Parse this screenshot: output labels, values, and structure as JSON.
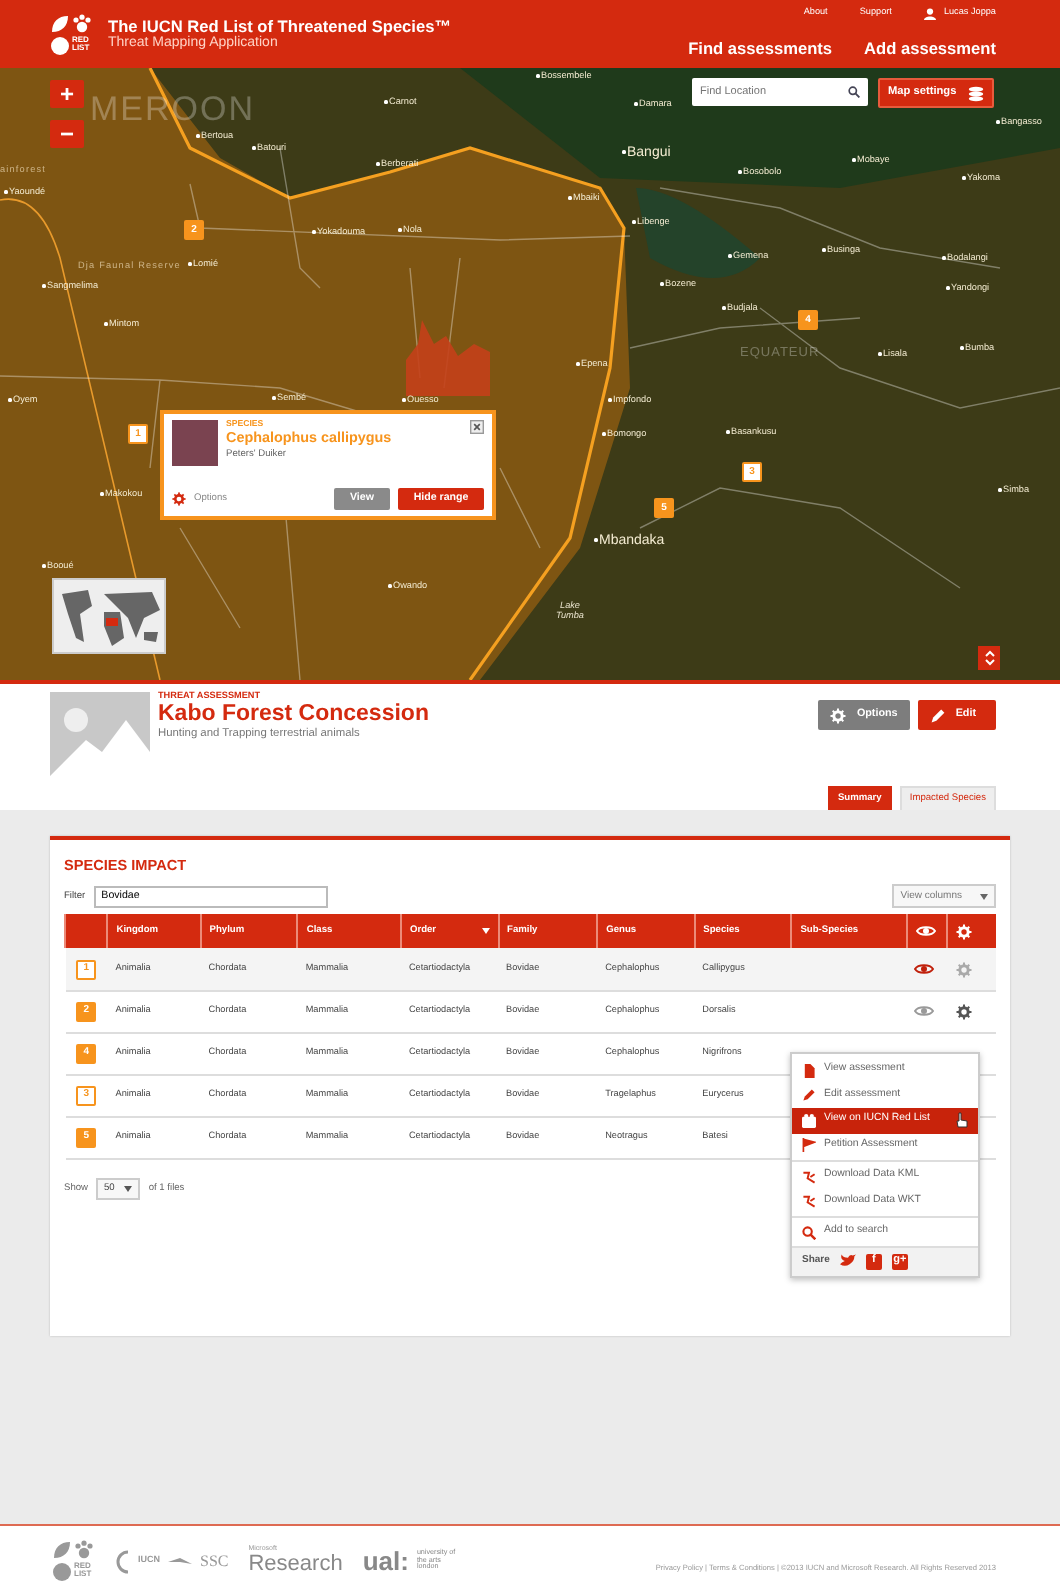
{
  "header": {
    "logo_text": "RED LIST",
    "title": "The IUCN Red List of Threatened Species™",
    "subtitle": "Threat Mapping Application",
    "top_links": [
      "About",
      "Support"
    ],
    "user": "Lucas Joppa",
    "nav": [
      "Find assessments",
      "Add assessment"
    ]
  },
  "map": {
    "zoom_in": "+",
    "zoom_out": "−",
    "search": {
      "placeholder": "Find Location"
    },
    "settings_button": "Map settings",
    "labels": [
      {
        "text": "MEROON",
        "kind": "region"
      },
      {
        "text": "ainforest",
        "kind": "area"
      },
      {
        "text": "Yaoundé",
        "kind": "town"
      },
      {
        "text": "Bossembele",
        "kind": "town"
      },
      {
        "text": "Carnot",
        "kind": "town"
      },
      {
        "text": "Bertoua",
        "kind": "town"
      },
      {
        "text": "Batouri",
        "kind": "town"
      },
      {
        "text": "Berberati",
        "kind": "town"
      },
      {
        "text": "Mbaiki",
        "kind": "town"
      },
      {
        "text": "Damara",
        "kind": "town"
      },
      {
        "text": "Bangui",
        "kind": "city"
      },
      {
        "text": "Bosobolo",
        "kind": "town"
      },
      {
        "text": "Mobaye",
        "kind": "town"
      },
      {
        "text": "Bangasso",
        "kind": "town"
      },
      {
        "text": "Yakoma",
        "kind": "town"
      },
      {
        "text": "Yokadouma",
        "kind": "town"
      },
      {
        "text": "Nola",
        "kind": "town"
      },
      {
        "text": "Libenge",
        "kind": "town"
      },
      {
        "text": "Gemena",
        "kind": "town"
      },
      {
        "text": "Businga",
        "kind": "town"
      },
      {
        "text": "Bodalangi",
        "kind": "town"
      },
      {
        "text": "Yandongi",
        "kind": "town"
      },
      {
        "text": "Dja Faunal Reserve",
        "kind": "area"
      },
      {
        "text": "Lomié",
        "kind": "town"
      },
      {
        "text": "Sangmelima",
        "kind": "town"
      },
      {
        "text": "Mintom",
        "kind": "town"
      },
      {
        "text": "Bozene",
        "kind": "town"
      },
      {
        "text": "Budjala",
        "kind": "town"
      },
      {
        "text": "EQUATEUR",
        "kind": "province"
      },
      {
        "text": "Lisala",
        "kind": "town"
      },
      {
        "text": "Bumba",
        "kind": "town"
      },
      {
        "text": "Epena",
        "kind": "town"
      },
      {
        "text": "Oyem",
        "kind": "town"
      },
      {
        "text": "Sembé",
        "kind": "town"
      },
      {
        "text": "Ouesso",
        "kind": "town"
      },
      {
        "text": "Impfondo",
        "kind": "town"
      },
      {
        "text": "Bomongo",
        "kind": "town"
      },
      {
        "text": "Basankusu",
        "kind": "town"
      },
      {
        "text": "Makokou",
        "kind": "town"
      },
      {
        "text": "Mbandaka",
        "kind": "city"
      },
      {
        "text": "Simba",
        "kind": "town"
      },
      {
        "text": "Booué",
        "kind": "town"
      },
      {
        "text": "Owando",
        "kind": "town"
      },
      {
        "text": "Lake Tumba",
        "kind": "lake"
      }
    ],
    "pins": [
      {
        "number": "2",
        "outlined": false
      },
      {
        "number": "4",
        "outlined": false
      },
      {
        "number": "1",
        "outlined": true
      },
      {
        "number": "3",
        "outlined": true
      },
      {
        "number": "5",
        "outlined": false
      }
    ],
    "popup": {
      "category": "SPECIES",
      "name": "Cephalophus callipygus",
      "common_name": "Peters' Duiker",
      "options": "Options",
      "buttons": [
        "View",
        "Hide range"
      ]
    }
  },
  "assessment": {
    "kicker": "THREAT ASSESSMENT",
    "title": "Kabo Forest Concession",
    "subtitle": "Hunting and Trapping terrestrial animals",
    "buttons": [
      "Options",
      "Edit"
    ],
    "tabs": [
      {
        "label": "Summary",
        "selected": true
      },
      {
        "label": "Impacted Species",
        "selected": false
      }
    ]
  },
  "species_impact": {
    "title": "SPECIES IMPACT",
    "filter": {
      "label": "Filter",
      "value": "Bovidae"
    },
    "view_columns": "View columns",
    "columns": [
      {
        "label": "Kingdom",
        "sorted": false
      },
      {
        "label": "Phylum",
        "sorted": false
      },
      {
        "label": "Class",
        "sorted": false
      },
      {
        "label": "Order",
        "sorted": true
      },
      {
        "label": "Family",
        "sorted": false
      },
      {
        "label": "Genus",
        "sorted": false
      },
      {
        "label": "Species",
        "sorted": false
      },
      {
        "label": "Sub-Species",
        "sorted": false
      }
    ],
    "rows": [
      {
        "marker": "1",
        "outlined": true,
        "cells": [
          "Animalia",
          "Chordata",
          "Mammalia",
          "Cetartiodactyla",
          "Bovidae",
          "Cephalophus",
          "Callipygus"
        ],
        "visible": true,
        "menu_open": false
      },
      {
        "marker": "2",
        "outlined": false,
        "cells": [
          "Animalia",
          "Chordata",
          "Mammalia",
          "Cetartiodactyla",
          "Bovidae",
          "Cephalophus",
          "Dorsalis"
        ],
        "visible": false,
        "menu_open": true
      },
      {
        "marker": "4",
        "outlined": false,
        "cells": [
          "Animalia",
          "Chordata",
          "Mammalia",
          "Cetartiodactyla",
          "Bovidae",
          "Cephalophus",
          "Nigrifrons"
        ]
      },
      {
        "marker": "3",
        "outlined": true,
        "cells": [
          "Animalia",
          "Chordata",
          "Mammalia",
          "Cetartiodactyla",
          "Bovidae",
          "Tragelaphus",
          "Eurycerus"
        ]
      },
      {
        "marker": "5",
        "outlined": false,
        "cells": [
          "Animalia",
          "Chordata",
          "Mammalia",
          "Cetartiodactyla",
          "Bovidae",
          "Neotragus",
          "Batesi"
        ]
      }
    ],
    "menu": {
      "groups": [
        [
          {
            "label": "View assessment",
            "selected": false
          },
          {
            "label": "Edit assessment",
            "selected": false
          },
          {
            "label": "View on IUCN Red List",
            "selected": true
          },
          {
            "label": "Petition Assessment",
            "selected": false
          }
        ],
        [
          {
            "label": "Download Data KML",
            "selected": false
          },
          {
            "label": "Download Data WKT",
            "selected": false
          }
        ],
        [
          {
            "label": "Add to search",
            "selected": false
          }
        ]
      ],
      "share": {
        "label": "Share",
        "icons": [
          "f",
          "g+"
        ]
      }
    },
    "pagination": {
      "label": "Show",
      "page_size": "50",
      "suffix": "of 1 files"
    }
  },
  "footer": {
    "logo_text": "RED LIST",
    "partners": [
      "IUCN",
      "SSC"
    ],
    "research": {
      "small": "Microsoft",
      "big": "Research"
    },
    "university": {
      "mark": "ual:",
      "name": "university of the arts london"
    },
    "legal": "Privacy Policy | Terms & Conditions | ©2013 IUCN and Microsoft Research. All Rights Reserved 2013"
  }
}
